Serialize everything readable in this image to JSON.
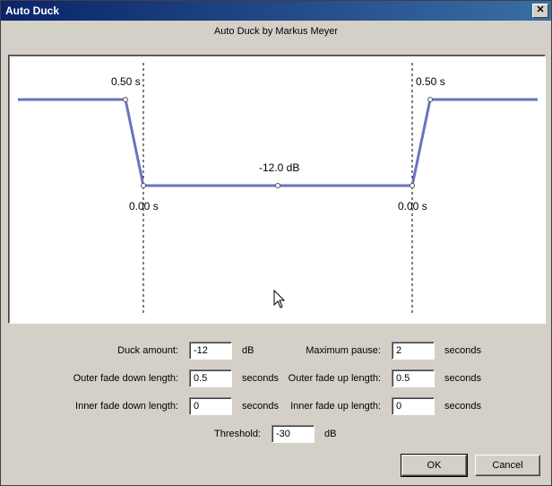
{
  "window": {
    "title": "Auto Duck",
    "close_glyph": "✕"
  },
  "subtitle": "Auto Duck by Markus Meyer",
  "graph": {
    "left_outer_label": "0.50 s",
    "right_outer_label": "0.50 s",
    "left_inner_label": "0.00 s",
    "right_inner_label": "0.00 s",
    "duck_label": "-12.0 dB",
    "line_color": "#6a72c4"
  },
  "fields": {
    "duck_amount": {
      "label": "Duck amount:",
      "value": "-12",
      "unit": "dB"
    },
    "max_pause": {
      "label": "Maximum pause:",
      "value": "2",
      "unit": "seconds"
    },
    "outer_fade_down": {
      "label": "Outer fade down length:",
      "value": "0.5",
      "unit": "seconds"
    },
    "outer_fade_up": {
      "label": "Outer fade up length:",
      "value": "0.5",
      "unit": "seconds"
    },
    "inner_fade_down": {
      "label": "Inner fade down length:",
      "value": "0",
      "unit": "seconds"
    },
    "inner_fade_up": {
      "label": "Inner fade up length:",
      "value": "0",
      "unit": "seconds"
    },
    "threshold": {
      "label": "Threshold:",
      "value": "-30",
      "unit": "dB"
    }
  },
  "buttons": {
    "ok": "OK",
    "cancel": "Cancel"
  }
}
